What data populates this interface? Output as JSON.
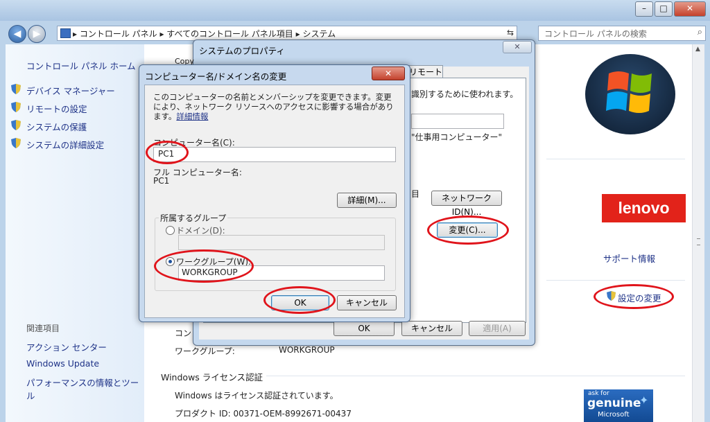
{
  "window": {
    "minimize": "–",
    "maximize": "□",
    "close": "✕"
  },
  "nav": {
    "back": "◀",
    "forward": "▶",
    "address_path": "▸ コントロール パネル ▸ すべてのコントロール パネル項目 ▸ システム",
    "search_placeholder": "コントロール パネルの検索"
  },
  "sidebar": {
    "home": "コントロール パネル ホーム",
    "items": [
      {
        "label": "デバイス マネージャー"
      },
      {
        "label": "リモートの設定"
      },
      {
        "label": "システムの保護"
      },
      {
        "label": "システムの詳細設定"
      }
    ],
    "related_heading": "関連項目",
    "related": [
      {
        "label": "アクション センター"
      },
      {
        "label": "Windows Update"
      },
      {
        "label": "パフォーマンスの情報とツール"
      }
    ]
  },
  "main": {
    "support_info": "サポート情報",
    "change_settings": "設定の変更",
    "workgroup_label": "ワークグループ:",
    "workgroup_value": "WORKGROUP",
    "license_heading": "Windows ライセンス認証",
    "license_status": "Windows はライセンス認証されています。",
    "product_id": "プロダクト ID: 00371-OEM-8992671-00437",
    "brand_logo": "lenovo",
    "genuine_ask": "ask for",
    "genuine_word": "genuine",
    "genuine_ms": "Microsoft",
    "partial_label": "コン"
  },
  "system_properties": {
    "title": "システムのプロパティ",
    "close": "✕",
    "tab_partial": "Copy",
    "tab_remote": "リモート",
    "desc_fragment": "識別するために使われます。",
    "example_fragment": "\"仕事用コンピューター\"",
    "network_id_button": "ネットワーク ID(N)...",
    "change_button": "変更(C)...",
    "ok": "OK",
    "cancel": "キャンセル",
    "apply": "適用(A)",
    "partial_fragment": "目"
  },
  "computer_name_dialog": {
    "title": "コンピューター名/ドメイン名の変更",
    "close": "✕",
    "description": "このコンピューターの名前とメンバーシップを変更できます。変更により、ネットワーク リソースへのアクセスに影響する場合があります。",
    "details_link": "詳細情報",
    "computer_name_label": "コンピューター名(C):",
    "computer_name_value": "PC1",
    "full_name_label": "フル コンピューター名:",
    "full_name_value": "PC1",
    "more_button": "詳細(M)...",
    "member_of_label": "所属するグループ",
    "domain_label": "ドメイン(D):",
    "workgroup_label": "ワークグループ(W):",
    "workgroup_value": "WORKGROUP",
    "ok": "OK",
    "cancel": "キャンセル"
  },
  "colors": {
    "annotation_ring": "#e0141b",
    "link": "#1e3287",
    "lenovo": "#e2231a"
  }
}
